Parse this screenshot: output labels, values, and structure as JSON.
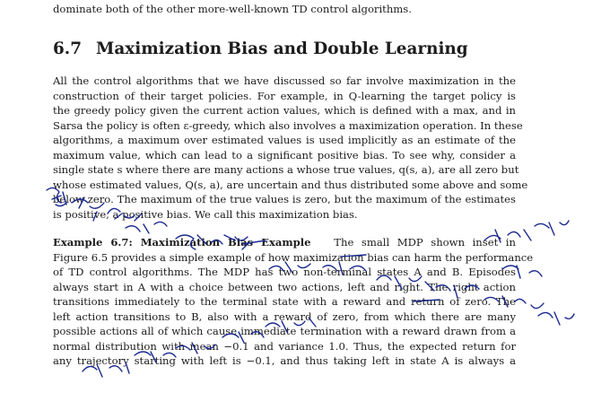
{
  "top_line": "dominate both of the other more-well-known TD control algorithms.",
  "section": {
    "number": "6.7",
    "title": "Maximization Bias and Double Learning"
  },
  "paragraph1": [
    "All the control algorithms that we have discussed so far involve maximization in the",
    "construction of their target policies. For example, in Q-learning the target policy is",
    "the greedy policy given the current action values, which is defined with a max, and in",
    "Sarsa the policy is often ε-greedy, which also involves a maximization operation. In these",
    "algorithms, a maximum over estimated values is used implicitly as an estimate of the",
    "maximum value, which can lead to a significant positive bias. To see why, consider a",
    "single state s where there are many actions a whose true values, q(s, a), are all zero but",
    "whose estimated values, Q(s, a), are uncertain and thus distributed some above and some",
    "below zero. The maximum of the true values is zero, but the maximum of the estimates",
    "is positive, a positive bias. We call this maximization bias."
  ],
  "example": {
    "heading": "Example 6.7: Maximization Bias Example",
    "lines": [
      "The small MDP shown inset in",
      "Figure 6.5 provides a simple example of how maximization bias can harm the performance",
      "of TD control algorithms. The MDP has two non-terminal states A and B. Episodes",
      "always start in A with a choice between two actions, left and right. The right action",
      "transitions immediately to the terminal state with a reward and return of zero. The",
      "left action transitions to B, also with a reward of zero, from which there are many",
      "possible actions all of which cause immediate termination with a reward drawn from a",
      "normal distribution with mean −0.1 and variance 1.0. Thus, the expected return for",
      "any trajectory starting with left is −0.1, and thus taking left in state A is always a"
    ]
  },
  "handwriting": {
    "note": "handwritten Chinese annotations in blue ink overlaid on the text",
    "color": "#1b2a8f"
  }
}
